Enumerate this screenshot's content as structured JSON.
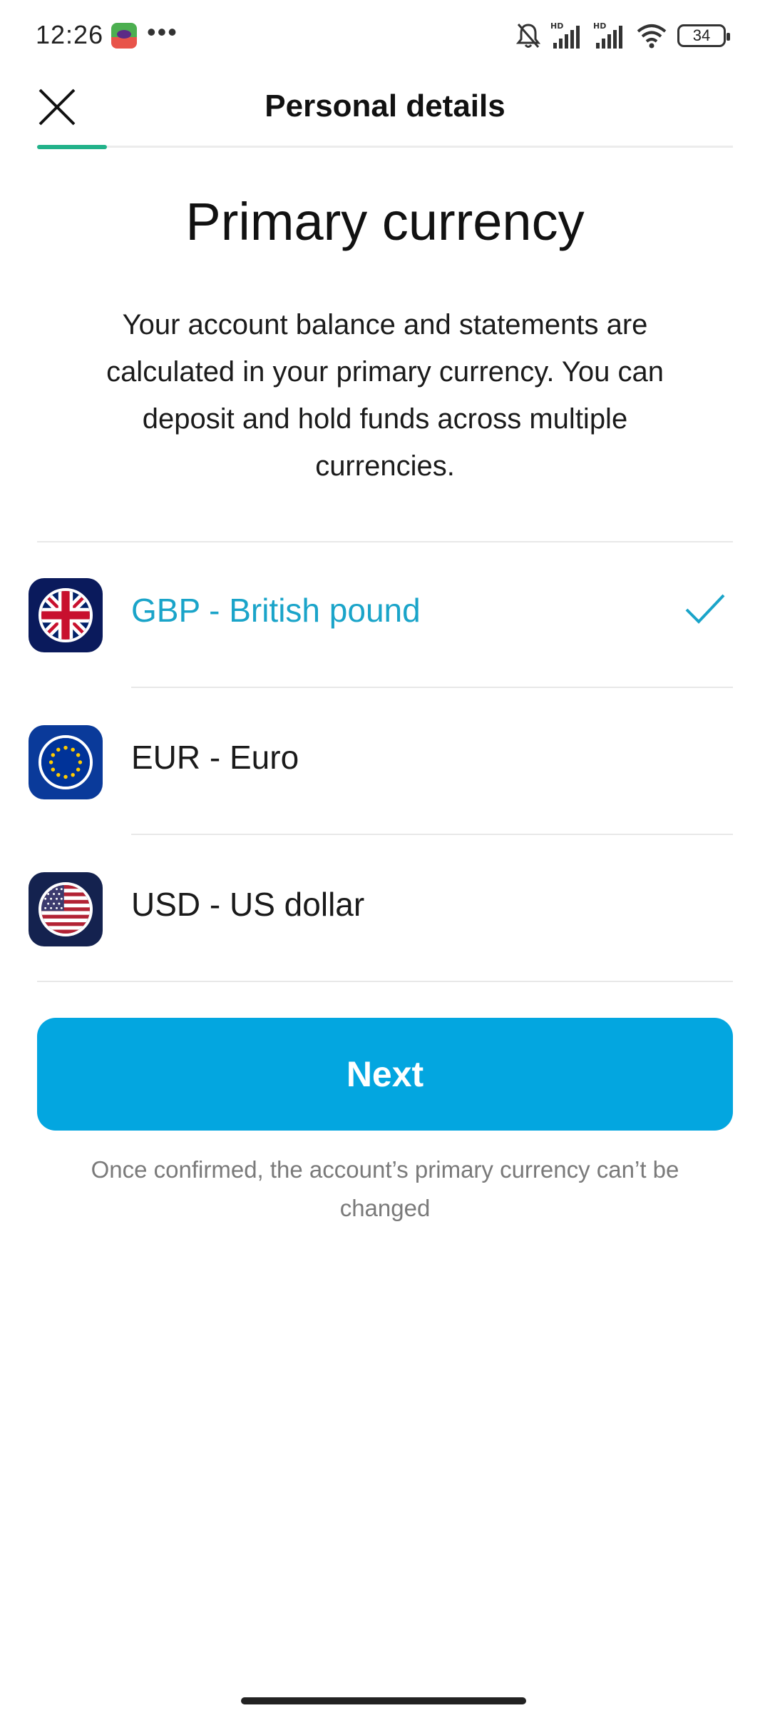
{
  "status_bar": {
    "time": "12:26",
    "more": "•••",
    "battery": "34",
    "icons": [
      "app-notification-icon",
      "bell-muted-icon",
      "hd-signal-icon",
      "hd-signal-icon",
      "wifi-icon",
      "battery-icon"
    ]
  },
  "header": {
    "title": "Personal details",
    "close_icon": "close-icon",
    "progress": 0.1
  },
  "content": {
    "heading": "Primary currency",
    "description": "Your account balance and statements are calculated in your primary currency. You can deposit and hold funds across multiple currencies."
  },
  "currencies": [
    {
      "label": "GBP - British pound",
      "flag": "uk-flag-icon",
      "tile_color": "#0a1a5c",
      "selected": true
    },
    {
      "label": "EUR - Euro",
      "flag": "eu-flag-icon",
      "tile_color": "#0a3a9a",
      "selected": false
    },
    {
      "label": "USD - US dollar",
      "flag": "us-flag-icon",
      "tile_color": "#14224f",
      "selected": false
    }
  ],
  "colors": {
    "accent": "#03a6e0",
    "selected_text": "#1aa4c9",
    "progress": "#22b28a"
  },
  "actions": {
    "next_label": "Next"
  },
  "footnote": "Once confirmed, the account’s primary currency can’t be changed"
}
